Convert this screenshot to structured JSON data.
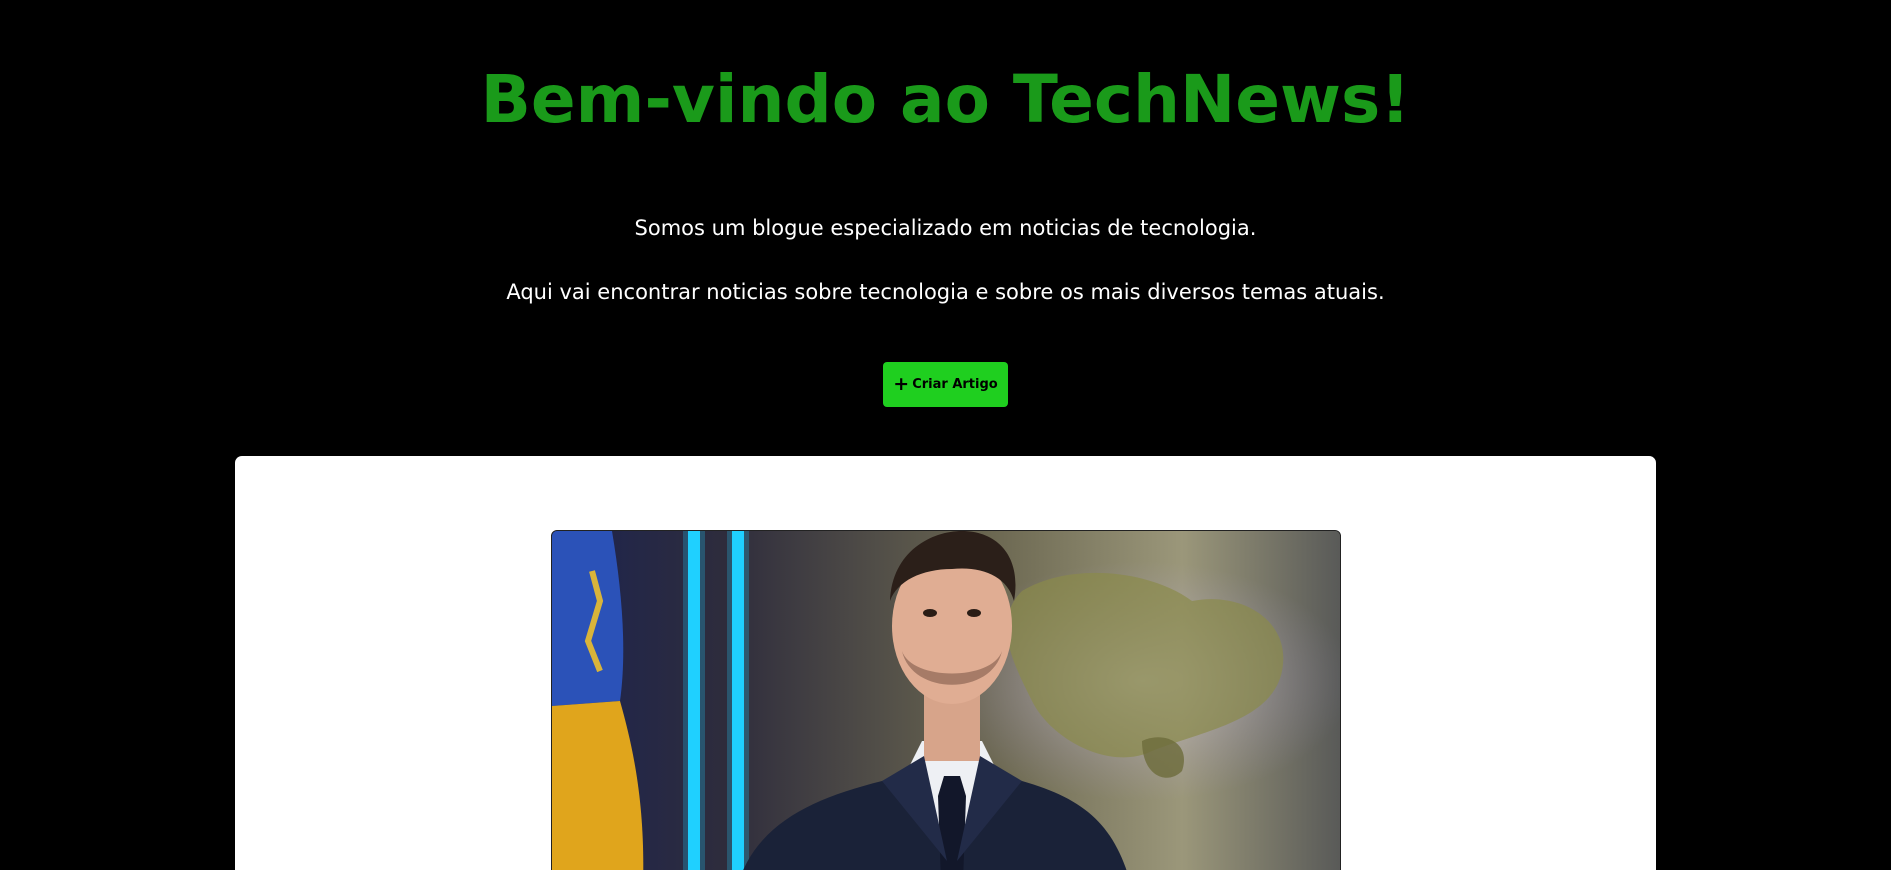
{
  "hero": {
    "title": "Bem-vindo ao TechNews!",
    "intro_line1": "Somos um blogue especializado em noticias de tecnologia.",
    "intro_line2": "Aqui vai encontrar noticias sobre tecnologia e sobre os mais diversos temas atuais."
  },
  "actions": {
    "create_article_label": "Criar Artigo",
    "create_article_icon": "plus-icon"
  },
  "colors": {
    "title_green": "#1a9a1a",
    "button_green": "#1fcf1f",
    "background": "#000000",
    "card": "#ffffff"
  },
  "article": {
    "image_icon": "article-photo"
  }
}
